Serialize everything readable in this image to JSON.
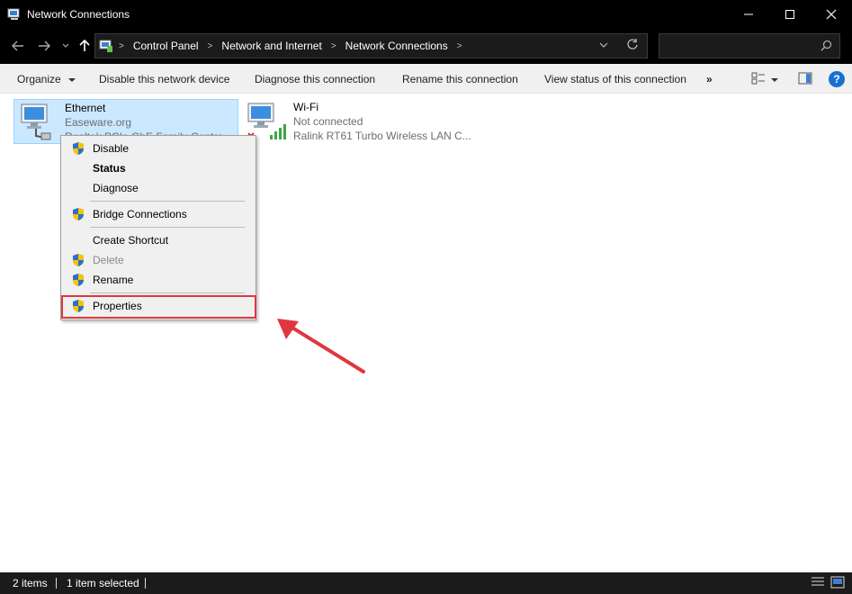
{
  "window": {
    "title": "Network Connections"
  },
  "title_controls": {
    "minimize": "—",
    "maximize": "☐",
    "close": "✕"
  },
  "nav": {
    "back": "←",
    "forward": "→",
    "recent": "⌄",
    "up": "↑"
  },
  "address": {
    "crumbs": [
      "Control Panel",
      "Network and Internet",
      "Network Connections"
    ],
    "dropdown": "⌄",
    "refresh": "↻"
  },
  "search": {
    "placeholder": ""
  },
  "toolbar": {
    "organize": "Organize",
    "disable": "Disable this network device",
    "diagnose": "Diagnose this connection",
    "rename": "Rename this connection",
    "view_status": "View status of this connection",
    "more": "»",
    "help": "?"
  },
  "connections": [
    {
      "name": "Ethernet",
      "status": "Easeware.org",
      "device": "Realtek PCIe GbE Family Controller"
    },
    {
      "name": "Wi-Fi",
      "status": "Not connected",
      "device": "Ralink RT61 Turbo Wireless LAN C..."
    }
  ],
  "context_menu": {
    "items": [
      {
        "label": "Disable",
        "icon": "uac-shield-icon"
      },
      {
        "label": "Status",
        "icon": ""
      },
      {
        "label": "Diagnose",
        "icon": ""
      },
      {
        "label": "Bridge Connections",
        "icon": "uac-shield-icon"
      },
      {
        "label": "Create Shortcut",
        "icon": ""
      },
      {
        "label": "Delete",
        "icon": "uac-shield-icon"
      },
      {
        "label": "Rename",
        "icon": "uac-shield-icon"
      },
      {
        "label": "Properties",
        "icon": "uac-shield-icon"
      }
    ]
  },
  "status_bar": {
    "items_count": "2 items",
    "selected": "1 item selected"
  },
  "colors": {
    "accent_highlight": "#e0373f",
    "selection_bg": "#cce8ff",
    "titlebar": "#000000"
  }
}
